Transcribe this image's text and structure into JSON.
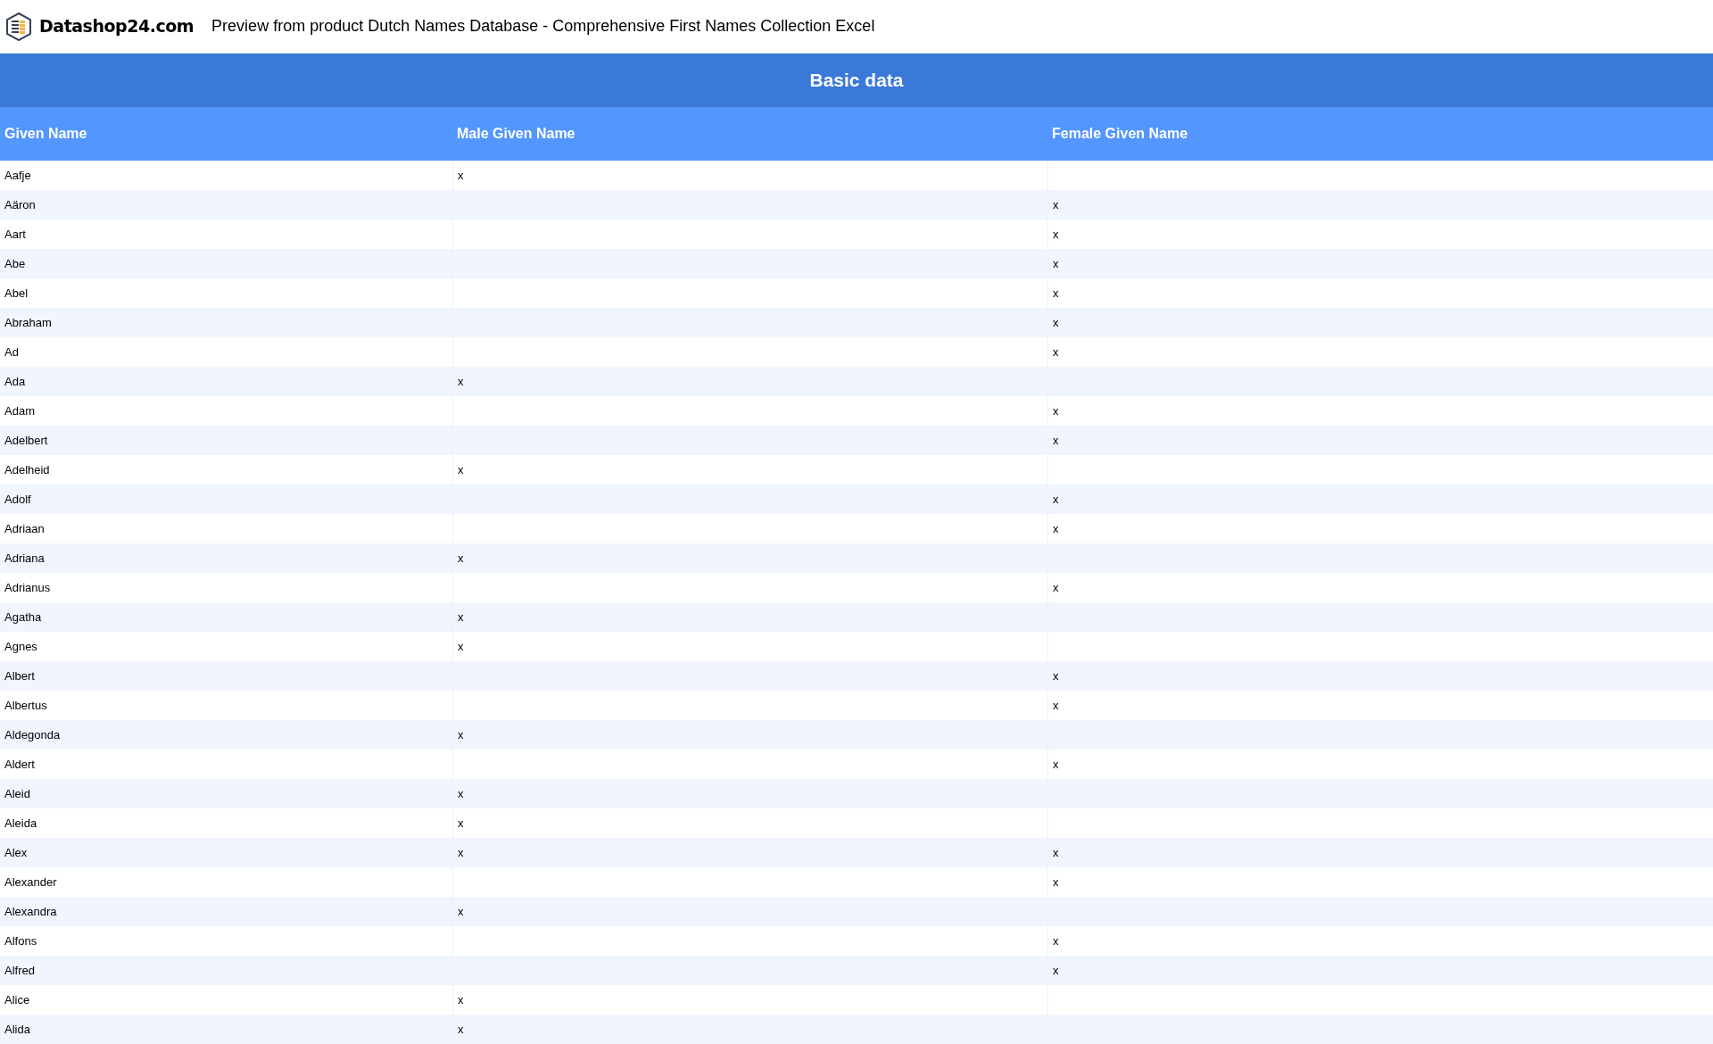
{
  "header": {
    "brand": "Datashop24.com",
    "title": "Preview from product Dutch Names Database - Comprehensive First Names Collection Excel"
  },
  "table": {
    "title": "Basic data",
    "columns": [
      "Given Name",
      "Male Given Name",
      "Female Given Name"
    ],
    "rows": [
      {
        "name": "Aafje",
        "male": "x"
      },
      {
        "name": "Aäron",
        "female": "x"
      },
      {
        "name": "Aart",
        "female": "x"
      },
      {
        "name": "Abe",
        "female": "x"
      },
      {
        "name": "Abel",
        "female": "x"
      },
      {
        "name": "Abraham",
        "female": "x"
      },
      {
        "name": "Ad",
        "female": "x"
      },
      {
        "name": "Ada",
        "male": "x"
      },
      {
        "name": "Adam",
        "female": "x"
      },
      {
        "name": "Adelbert",
        "female": "x"
      },
      {
        "name": "Adelheid",
        "male": "x"
      },
      {
        "name": "Adolf",
        "female": "x"
      },
      {
        "name": "Adriaan",
        "female": "x"
      },
      {
        "name": "Adriana",
        "male": "x"
      },
      {
        "name": "Adrianus",
        "female": "x"
      },
      {
        "name": "Agatha",
        "male": "x"
      },
      {
        "name": "Agnes",
        "male": "x"
      },
      {
        "name": "Albert",
        "female": "x"
      },
      {
        "name": "Albertus",
        "female": "x"
      },
      {
        "name": "Aldegonda",
        "male": "x"
      },
      {
        "name": "Aldert",
        "female": "x"
      },
      {
        "name": "Aleid",
        "male": "x"
      },
      {
        "name": "Aleida",
        "male": "x"
      },
      {
        "name": "Alex",
        "male": "x",
        "female": "x"
      },
      {
        "name": "Alexander",
        "female": "x"
      },
      {
        "name": "Alexandra",
        "male": "x"
      },
      {
        "name": "Alfons",
        "female": "x"
      },
      {
        "name": "Alfred",
        "female": "x"
      },
      {
        "name": "Alice",
        "male": "x"
      },
      {
        "name": "Alida",
        "male": "x"
      }
    ]
  }
}
